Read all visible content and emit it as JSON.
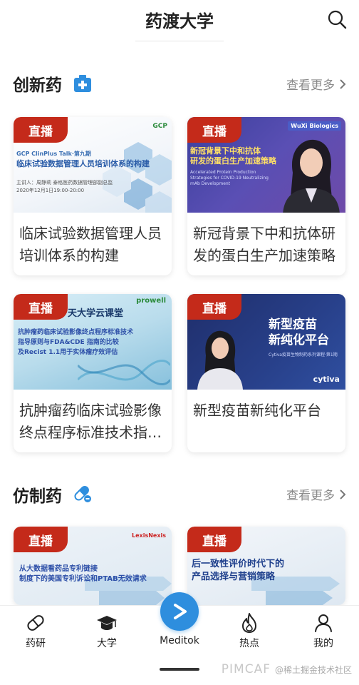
{
  "header": {
    "title": "药渡大学",
    "search_icon": "search-icon"
  },
  "sections": [
    {
      "title": "创新药",
      "icon": "medical-kit-icon",
      "more": "查看更多"
    },
    {
      "title": "仿制药",
      "icon": "pill-icon",
      "more": "查看更多"
    }
  ],
  "cards": [
    {
      "badge": "直播",
      "title": "临床试验数据管理人员培训体系的构建",
      "thumb": {
        "line1": "GCP ClinPlus Talk·第九期",
        "line2": "临床试验数据管理人员培训体系的构建",
        "line3": "主讲人：周静莉   泰格医药数据管理部副总监",
        "line4": "2020年12月1日19:00-20:00",
        "logo": "GCP"
      }
    },
    {
      "badge": "直播",
      "title": "新冠背景下中和抗体研发的蛋白生产加速策略",
      "thumb": {
        "line1": "新冠背景下中和抗体",
        "line2": "研发的蛋白生产加速策略",
        "line3": "Accelerated Protein Production Strategies for COVID-19 Neutralizing mAb Development",
        "logo": "WuXi Biologics"
      }
    },
    {
      "badge": "直播",
      "title": "抗肿瘤药临床试验影像终点程序标准技术指导原则",
      "thumb": {
        "line0": "天大学云课堂",
        "line1": "抗肿瘤药临床试验影像终点程序标准技术",
        "line2": "指导原则与FDA&CDE 指南的比较",
        "line3": "及Recist 1.1用于实体瘤疗效评估",
        "logo": "prowell"
      }
    },
    {
      "badge": "直播",
      "title": "新型疫苗新纯化平台",
      "thumb": {
        "line1": "新型疫苗",
        "line2": "新纯化平台",
        "line3": "Cytiva疫苗生物制药系列课程·第1期",
        "logo": "cytiva"
      }
    },
    {
      "badge": "直播",
      "title": "从大数据看药品专利链接制度下的美国专利诉讼和PTAB无效请求",
      "thumb": {
        "line1": "从大数据看药品专利链接",
        "line2": "制度下的美国专利诉讼和PTAB无效请求",
        "logo": "LexisNexis"
      }
    },
    {
      "badge": "直播",
      "title": "后一致性评价时代下的产品选择与营销策略",
      "thumb": {
        "line1": "后一致性评价时代下的",
        "line2": "产品选择与营销策略"
      }
    }
  ],
  "tabbar": {
    "items": [
      {
        "label": "药研",
        "icon": "capsule-icon"
      },
      {
        "label": "大学",
        "icon": "graduation-cap-icon"
      },
      {
        "label": "Meditok",
        "icon": "play-icon"
      },
      {
        "label": "热点",
        "icon": "flame-icon"
      },
      {
        "label": "我的",
        "icon": "user-icon"
      }
    ]
  },
  "watermark": {
    "text1": "PIMCAF",
    "text2": "@稀土掘金技术社区"
  },
  "colors": {
    "badge": "#c42a1a",
    "accent": "#2e8ede"
  }
}
